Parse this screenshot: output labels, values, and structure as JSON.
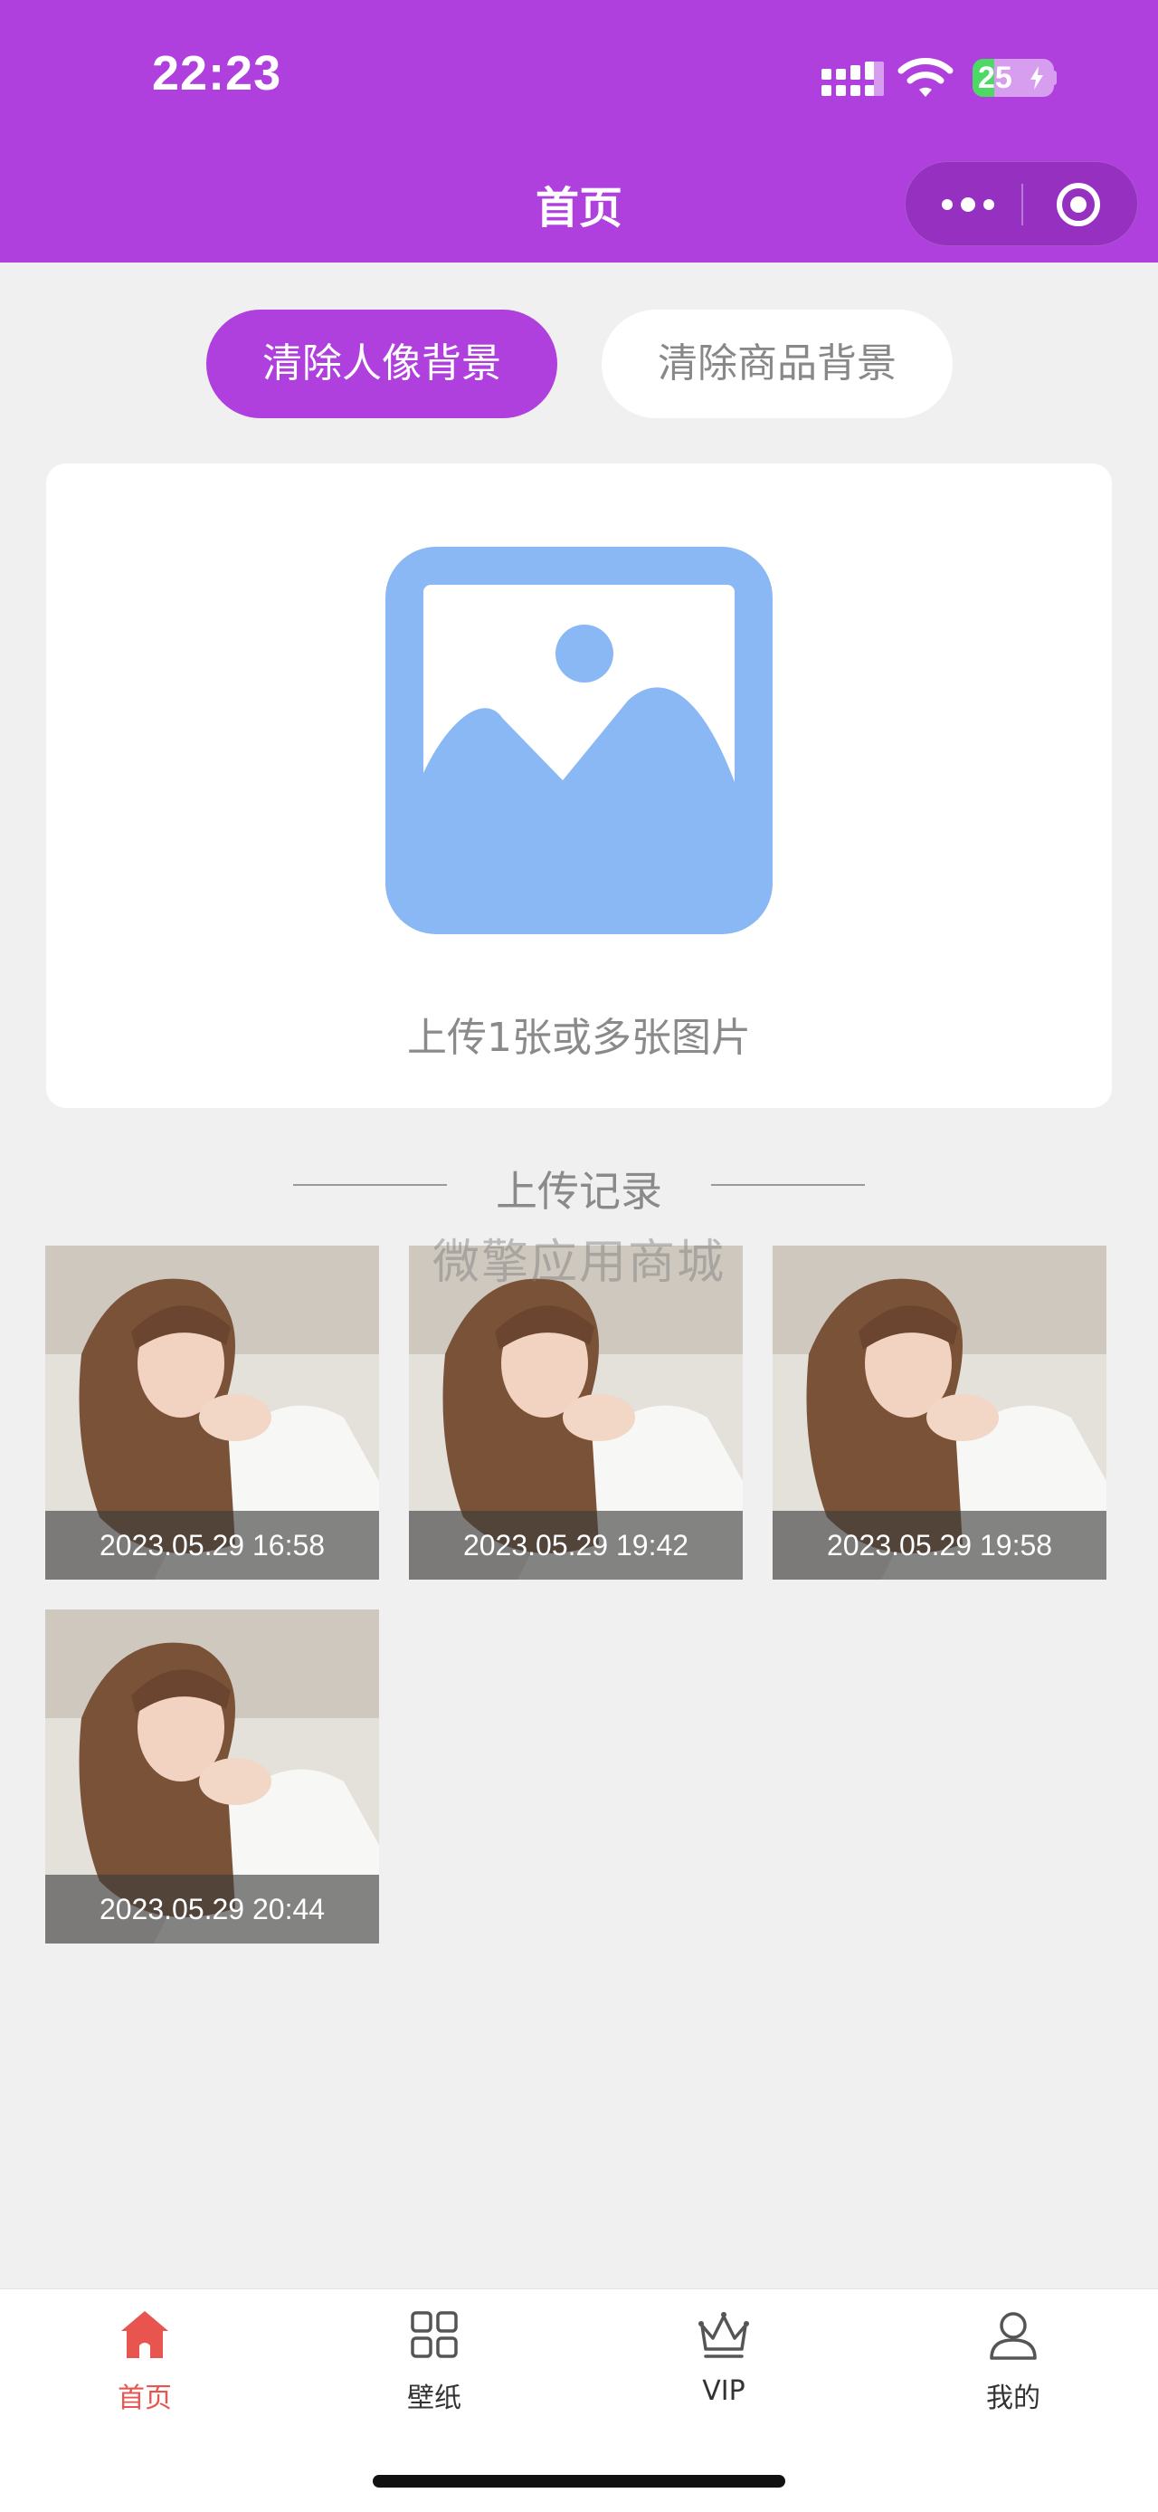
{
  "status_bar": {
    "time": "22:23",
    "battery": "25"
  },
  "nav": {
    "title": "首页"
  },
  "segments": {
    "portrait": "清除人像背景",
    "product": "清除商品背景"
  },
  "upload": {
    "text": "上传1张或多张图片"
  },
  "records": {
    "title": "上传记录",
    "watermark": "微擎应用商城",
    "items": [
      {
        "time": "2023.05.29 16:58"
      },
      {
        "time": "2023.05.29 19:42"
      },
      {
        "time": "2023.05.29 19:58"
      },
      {
        "time": "2023.05.29 20:44"
      }
    ]
  },
  "tabbar": {
    "items": [
      {
        "label": "首页",
        "icon": "home-icon",
        "active": true
      },
      {
        "label": "壁纸",
        "icon": "grid-icon",
        "active": false
      },
      {
        "label": "VIP",
        "icon": "crown-icon",
        "active": false
      },
      {
        "label": "我的",
        "icon": "user-icon",
        "active": false
      }
    ]
  },
  "colors": {
    "accent": "#b040dd",
    "tab_active": "#e8554f",
    "upload_icon": "#8ab8f5"
  }
}
